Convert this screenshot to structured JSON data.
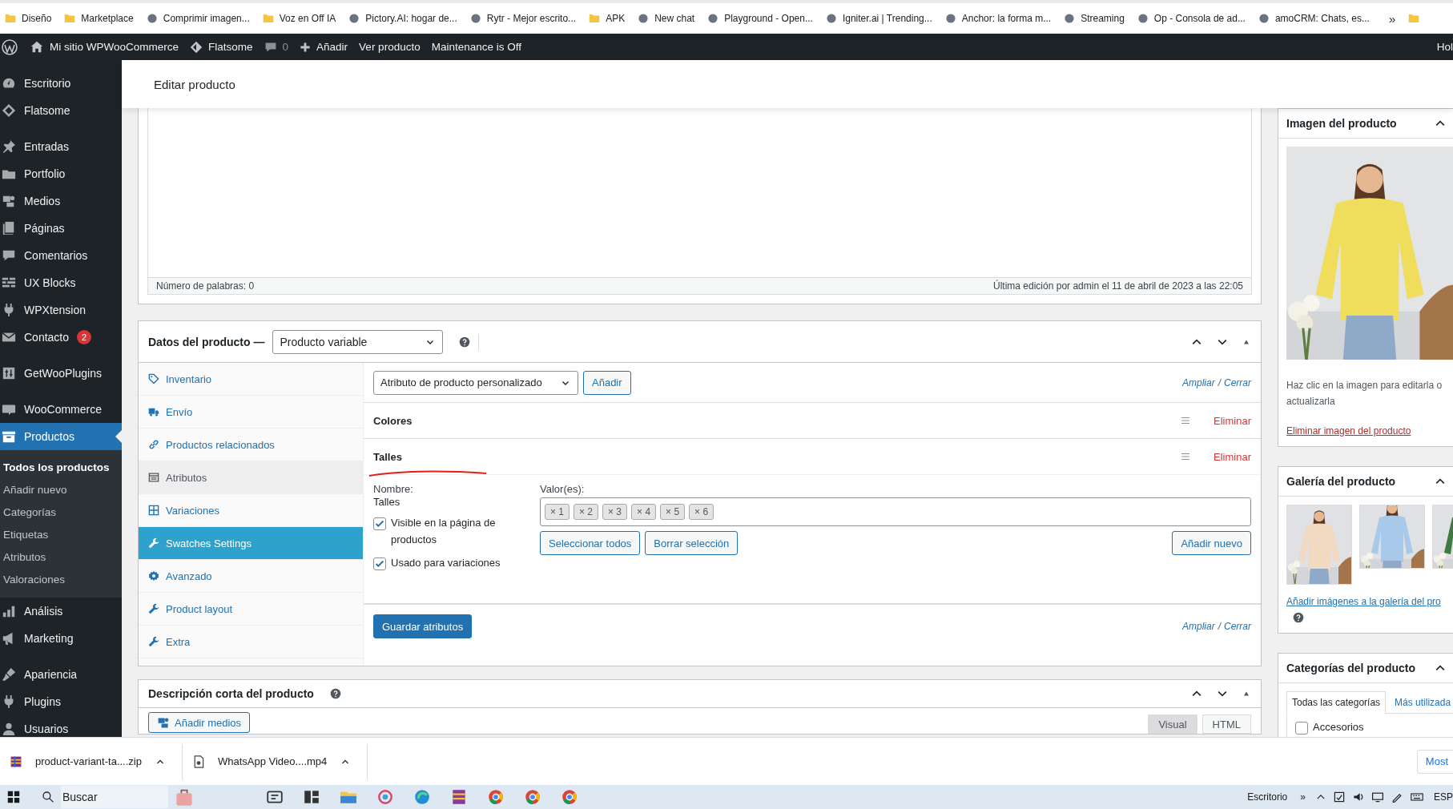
{
  "bookmarks": [
    {
      "label": "Diseño",
      "kind": "folder"
    },
    {
      "label": "Marketplace",
      "kind": "folder"
    },
    {
      "label": "Comprimir imagen...",
      "kind": "site"
    },
    {
      "label": "Voz en Off IA",
      "kind": "folder"
    },
    {
      "label": "Pictory.AI: hogar de...",
      "kind": "site"
    },
    {
      "label": "Rytr - Mejor escrito...",
      "kind": "site"
    },
    {
      "label": "APK",
      "kind": "folder"
    },
    {
      "label": "New chat",
      "kind": "site"
    },
    {
      "label": "Playground - Open...",
      "kind": "site"
    },
    {
      "label": "Igniter.ai | Trending...",
      "kind": "site"
    },
    {
      "label": "Anchor: la forma m...",
      "kind": "site"
    },
    {
      "label": "Streaming",
      "kind": "site"
    },
    {
      "label": "Op - Consola de ad...",
      "kind": "site"
    },
    {
      "label": "amoCRM: Chats, es...",
      "kind": "site"
    }
  ],
  "bookmarks_more": "»",
  "admin_bar": {
    "site": "Mi sitio WPWooCommerce",
    "theme": "Flatsome",
    "comments": "0",
    "new": "Añadir",
    "view": "Ver producto",
    "maintenance": "Maintenance is Off",
    "greeting": "Hol"
  },
  "sidebar": {
    "items": [
      {
        "label": "Escritorio",
        "selected": false
      },
      {
        "label": "Flatsome",
        "selected": false
      },
      {
        "label": "Entradas",
        "selected": false
      },
      {
        "label": "Portfolio",
        "selected": false
      },
      {
        "label": "Medios",
        "selected": false
      },
      {
        "label": "Páginas",
        "selected": false
      },
      {
        "label": "Comentarios",
        "selected": false
      },
      {
        "label": "UX Blocks",
        "selected": false
      },
      {
        "label": "WPXtension",
        "selected": false
      },
      {
        "label": "Contacto",
        "selected": false,
        "badge": "2"
      },
      {
        "label": "GetWooPlugins",
        "selected": false
      },
      {
        "label": "WooCommerce",
        "selected": false
      },
      {
        "label": "Productos",
        "selected": true,
        "children": [
          {
            "label": "Todos los productos",
            "selected": true
          },
          {
            "label": "Añadir nuevo",
            "selected": false
          },
          {
            "label": "Categorías",
            "selected": false
          },
          {
            "label": "Etiquetas",
            "selected": false
          },
          {
            "label": "Atributos",
            "selected": false
          },
          {
            "label": "Valoraciones",
            "selected": false
          }
        ]
      },
      {
        "label": "Análisis",
        "selected": false
      },
      {
        "label": "Marketing",
        "selected": false
      },
      {
        "label": "Apariencia",
        "selected": false
      },
      {
        "label": "Plugins",
        "selected": false
      },
      {
        "label": "Usuarios",
        "selected": false
      }
    ]
  },
  "page_title": "Editar producto",
  "editor": {
    "word_count": "Número de palabras: 0",
    "last_edit": "Última edición por admin el 11 de abril de 2023 a las 22:05"
  },
  "product_data": {
    "title": "Datos del producto —",
    "type_select": "Producto variable",
    "tabs": [
      {
        "label": "Inventario",
        "selected": false
      },
      {
        "label": "Envío",
        "selected": false
      },
      {
        "label": "Productos relacionados",
        "selected": false
      },
      {
        "label": "Atributos",
        "selected": false,
        "current": true
      },
      {
        "label": "Variaciones",
        "selected": false
      },
      {
        "label": "Swatches Settings",
        "selected": true
      },
      {
        "label": "Avanzado",
        "selected": false
      },
      {
        "label": "Product layout",
        "selected": false
      },
      {
        "label": "Extra",
        "selected": false
      }
    ],
    "attribute_select": "Atributo de producto personalizado",
    "add_button": "Añadir",
    "top_links": {
      "expand": "Ampliar",
      "slash": "/",
      "close": "Cerrar"
    },
    "attributes": [
      {
        "name": "Colores",
        "expanded": false,
        "remove": "Eliminar"
      },
      {
        "name": "Talles",
        "expanded": true,
        "remove": "Eliminar",
        "underlined": true,
        "name_label": "Nombre:",
        "name_value": "Talles",
        "values_label": "Valor(es):",
        "values": [
          "× 1",
          "× 2",
          "× 3",
          "× 4",
          "× 5",
          "× 6"
        ],
        "checkboxes": [
          {
            "label": "Visible en la página de productos",
            "checked": true
          },
          {
            "label": "Usado para variaciones",
            "checked": true
          }
        ],
        "buttons": [
          "Seleccionar todos",
          "Borrar selección"
        ],
        "add_new": "Añadir nuevo"
      }
    ],
    "save_button": "Guardar atributos",
    "bottom_links": {
      "expand": "Ampliar",
      "slash": "/",
      "close": "Cerrar"
    }
  },
  "short_description": {
    "title": "Descripción corta del producto",
    "media_button": "Añadir medios",
    "tabs": [
      {
        "label": "Visual",
        "selected": false
      },
      {
        "label": "HTML",
        "selected": true
      }
    ]
  },
  "product_image": {
    "title": "Imagen del producto",
    "image": {
      "kind": "picture"
    },
    "hint_lines": [
      "Haz clic en la imagen para editarla o",
      "actualizarla"
    ],
    "remove_link": "Eliminar imagen del producto"
  },
  "gallery": {
    "title": "Galería del producto",
    "images": [
      {
        "kind": "picture"
      },
      {
        "kind": "picture"
      },
      {
        "kind": "picture"
      }
    ],
    "add_link": "Añadir imágenes a la galería del pro"
  },
  "categories": {
    "title": "Categorías del producto",
    "tabs": [
      {
        "label": "Todas las categorías",
        "selected": true
      },
      {
        "label": "Más utilizada",
        "selected": false
      }
    ],
    "items": [
      {
        "label": "Accesorios",
        "checked": false
      }
    ]
  },
  "downloads": {
    "items": [
      {
        "name": "product-variant-ta....zip",
        "kind": "archive"
      },
      {
        "name": "WhatsApp Video....mp4",
        "kind": "video"
      }
    ],
    "show_all": "Most"
  },
  "taskbar": {
    "search_placeholder": "Buscar",
    "desktop": "Escritorio",
    "more": "»",
    "language": "ESP"
  }
}
